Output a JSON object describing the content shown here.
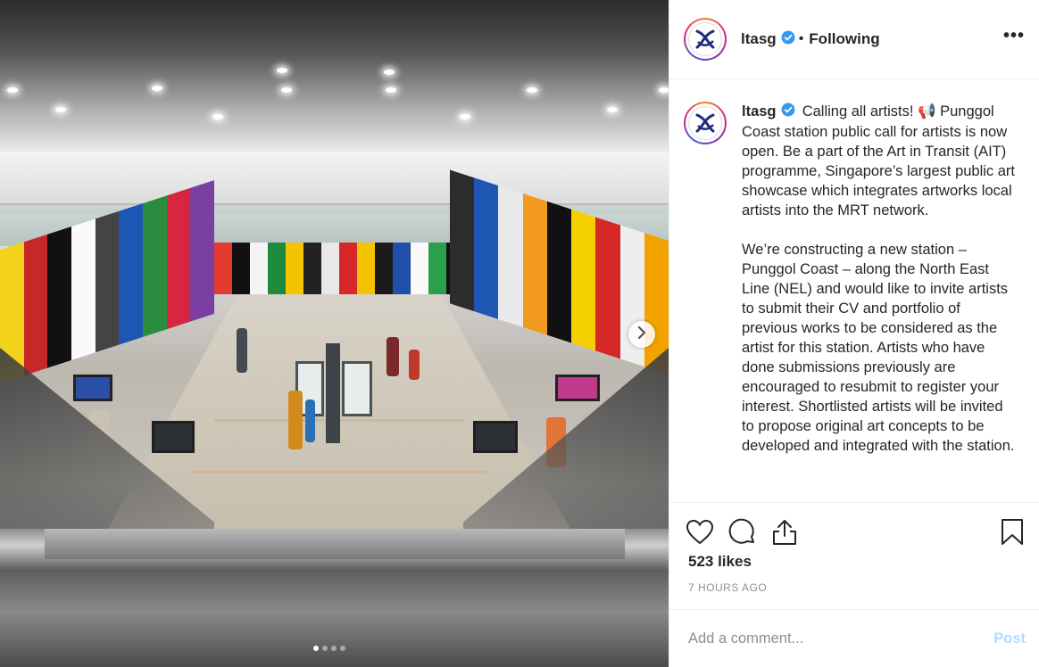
{
  "post": {
    "username": "ltasg",
    "follow_sep": "•",
    "follow_status": "Following",
    "more_label": "•••",
    "caption": {
      "username": "ltasg",
      "paragraph1": "Calling all artists! 📢 Punggol Coast station public call for artists is now open. Be a part of the Art in Transit (AIT) programme, Singapore’s largest public art showcase which integrates artworks local artists into the MRT network.",
      "paragraph2": "We’re constructing a new station – Punggol Coast – along the North East Line (NEL) and would like to invite artists to submit their CV and portfolio of previous works to be considered as the artist for this station. Artists who have done submissions previously are encouraged to resubmit to register your interest. Shortlisted artists will be invited to propose original art concepts to be developed and integrated with the station."
    },
    "likes": "523 likes",
    "timestamp": "7 HOURS AGO",
    "comment_placeholder": "Add a comment...",
    "post_button": "Post"
  },
  "carousel": {
    "slide_count": 4,
    "active_index": 0
  },
  "icons": {
    "verified": "verified-badge-icon",
    "heart": "heart-icon",
    "comment": "comment-icon",
    "share": "share-icon",
    "save": "bookmark-icon",
    "next": "chevron-right-icon"
  },
  "colors": {
    "verified": "#3897f0",
    "post_button_disabled": "#b3dbff",
    "muted_text": "#8e8e8e"
  }
}
